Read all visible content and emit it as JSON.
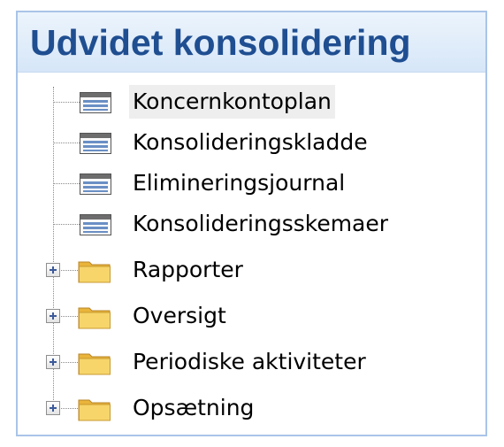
{
  "panel": {
    "title": "Udvidet konsolidering",
    "items": [
      {
        "label": "Koncernkontoplan",
        "icon": "form-icon",
        "selected": true
      },
      {
        "label": "Konsolideringskladde",
        "icon": "form-icon"
      },
      {
        "label": "Elimineringsjournal",
        "icon": "form-icon"
      },
      {
        "label": "Konsolideringsskemaer",
        "icon": "form-icon"
      },
      {
        "label": "Rapporter",
        "icon": "folder-icon",
        "expandable": true
      },
      {
        "label": "Oversigt",
        "icon": "folder-icon",
        "expandable": true
      },
      {
        "label": "Periodiske aktiviteter",
        "icon": "folder-icon",
        "expandable": true
      },
      {
        "label": "Opsætning",
        "icon": "folder-icon",
        "expandable": true
      }
    ]
  },
  "colors": {
    "title": "#1f4e91",
    "header_bg": "#dce9f8",
    "border": "#a9c4e8",
    "selected_bg": "#eeeeee",
    "folder": "#f2c84b"
  }
}
